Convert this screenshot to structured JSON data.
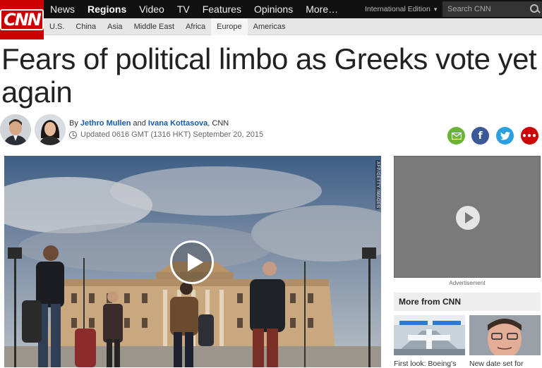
{
  "brand": {
    "logo_text": "CNN",
    "accent": "#cc0000"
  },
  "nav": {
    "main": [
      "News",
      "Regions",
      "Video",
      "TV",
      "Features",
      "Opinions",
      "More…"
    ],
    "active": "Regions",
    "edition": "International Edition",
    "search_placeholder": "Search CNN"
  },
  "subnav": {
    "items": [
      "U.S.",
      "China",
      "Asia",
      "Middle East",
      "Africa",
      "Europe",
      "Americas"
    ],
    "active": "Europe"
  },
  "article": {
    "headline": "Fears of political limbo as Greeks vote yet again",
    "byline": {
      "prefix": "By",
      "author1": "Jethro Mullen",
      "joiner": "and",
      "author2": "Ivana Kottasova",
      "outlet": ", CNN"
    },
    "updated": "Updated 0616 GMT (1316 HKT) September 20, 2015",
    "share_icons": [
      "mail-icon",
      "facebook-icon",
      "twitter-icon",
      "more-icon"
    ],
    "hero_credit": "AFP/GETTY IMAGES"
  },
  "sidebar": {
    "ad_label": "Advertisement",
    "more_title": "More from CNN",
    "items": [
      {
        "caption": "First look: Boeing's"
      },
      {
        "caption": "New date set for"
      }
    ]
  }
}
